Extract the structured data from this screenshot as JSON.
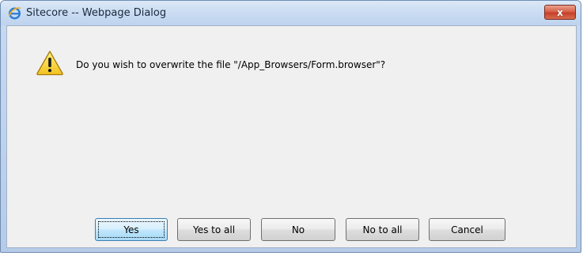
{
  "window": {
    "title": "Sitecore -- Webpage Dialog",
    "close_glyph": "x"
  },
  "dialog": {
    "message": "Do you wish to overwrite the file \"/App_Browsers/Form.browser\"?"
  },
  "buttons": {
    "yes": "Yes",
    "yes_to_all": "Yes to all",
    "no": "No",
    "no_to_all": "No to all",
    "cancel": "Cancel"
  },
  "icons": {
    "title": "internet-explorer-icon",
    "message": "warning-icon",
    "close": "close-icon"
  },
  "colors": {
    "warning_fill": "#f6d32b",
    "close_button": "#c7402a",
    "client_background": "#f0f0f0"
  }
}
